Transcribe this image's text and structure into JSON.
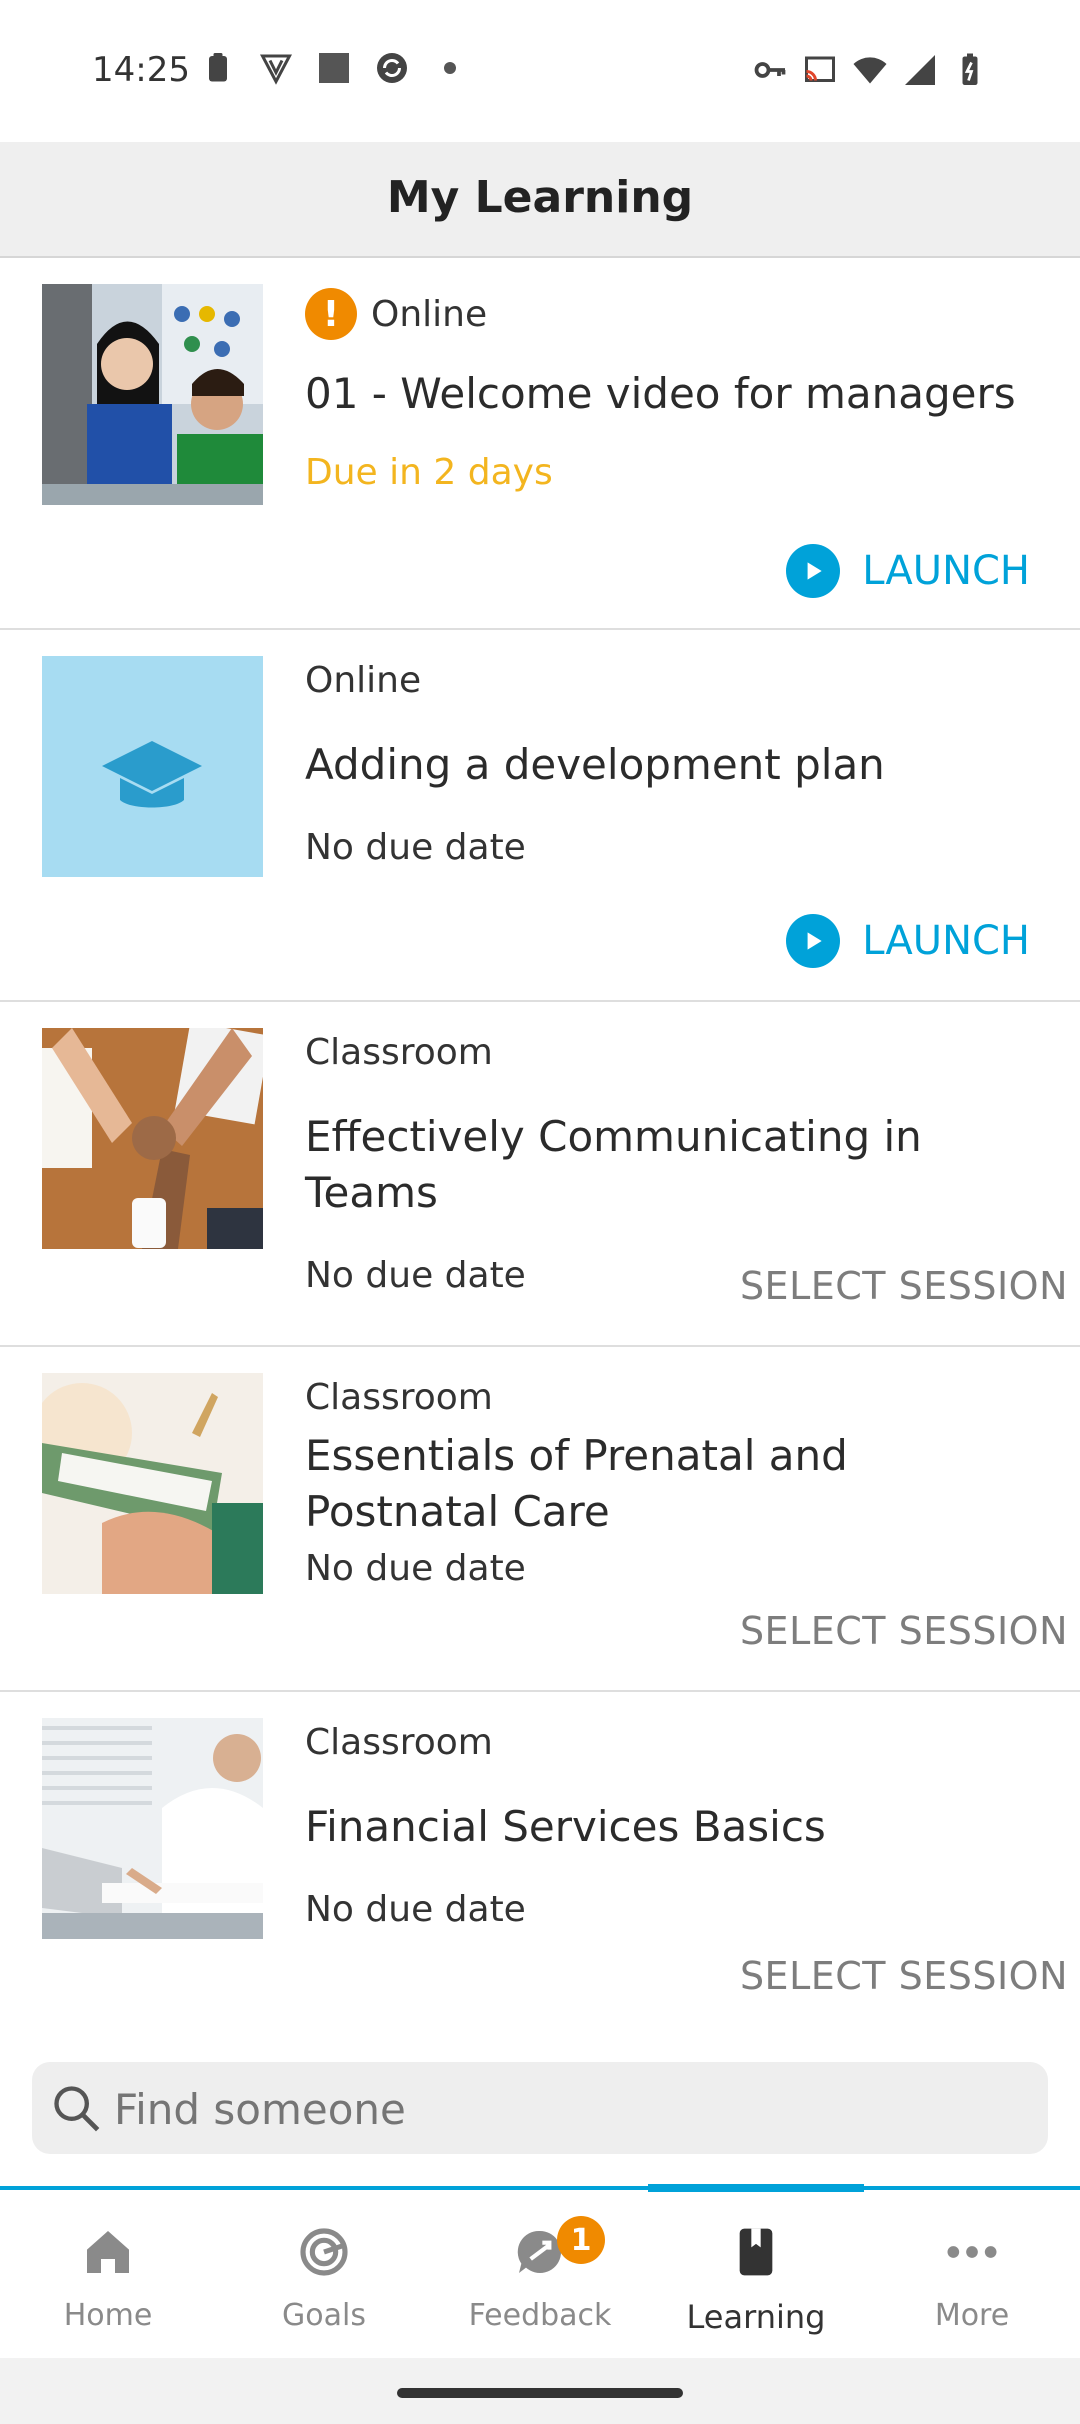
{
  "status_bar": {
    "time": "14:25",
    "left_icons": [
      "clipboard-icon",
      "shield-v-icon",
      "square-icon",
      "sync-icon",
      "dot-icon"
    ],
    "right_icons": [
      "key-icon",
      "cast-icon",
      "wifi-icon",
      "signal-icon",
      "battery-charging-icon"
    ]
  },
  "header": {
    "title": "My Learning"
  },
  "items": [
    {
      "type": "Online",
      "title": "01 - Welcome video for managers",
      "due": "Due in 2 days",
      "action": "LAUNCH",
      "warning_icon": "!",
      "thumbnail": "photo-people-smiling"
    },
    {
      "type": "Online",
      "title": "Adding a development plan",
      "due": "No due date",
      "action": "LAUNCH",
      "thumbnail": "graduation-cap-icon"
    },
    {
      "type": "Classroom",
      "title": "Effectively Communicating in Teams",
      "due": "No due date",
      "action": "SELECT SESSION",
      "thumbnail": "photo-fist-bump"
    },
    {
      "type": "Classroom",
      "title": "Essentials of Prenatal and Postnatal Care",
      "due": "No due date",
      "action": "SELECT SESSION",
      "thumbnail": "photo-clipboard"
    },
    {
      "type": "Classroom",
      "title": "Financial Services Basics",
      "due": "No due date",
      "action": "SELECT SESSION",
      "thumbnail": "photo-man-writing"
    }
  ],
  "search": {
    "placeholder": "Find someone"
  },
  "nav": {
    "items": [
      {
        "label": "Home",
        "icon": "home-icon"
      },
      {
        "label": "Goals",
        "icon": "target-icon"
      },
      {
        "label": "Feedback",
        "icon": "feedback-icon",
        "badge": "1"
      },
      {
        "label": "Learning",
        "icon": "book-icon",
        "active": true
      },
      {
        "label": "More",
        "icon": "more-dots-icon"
      }
    ]
  },
  "colors": {
    "accent": "#00a2d9",
    "warning": "#f08a00",
    "due_soon": "#f3b51f",
    "header_bg": "#efefef"
  }
}
